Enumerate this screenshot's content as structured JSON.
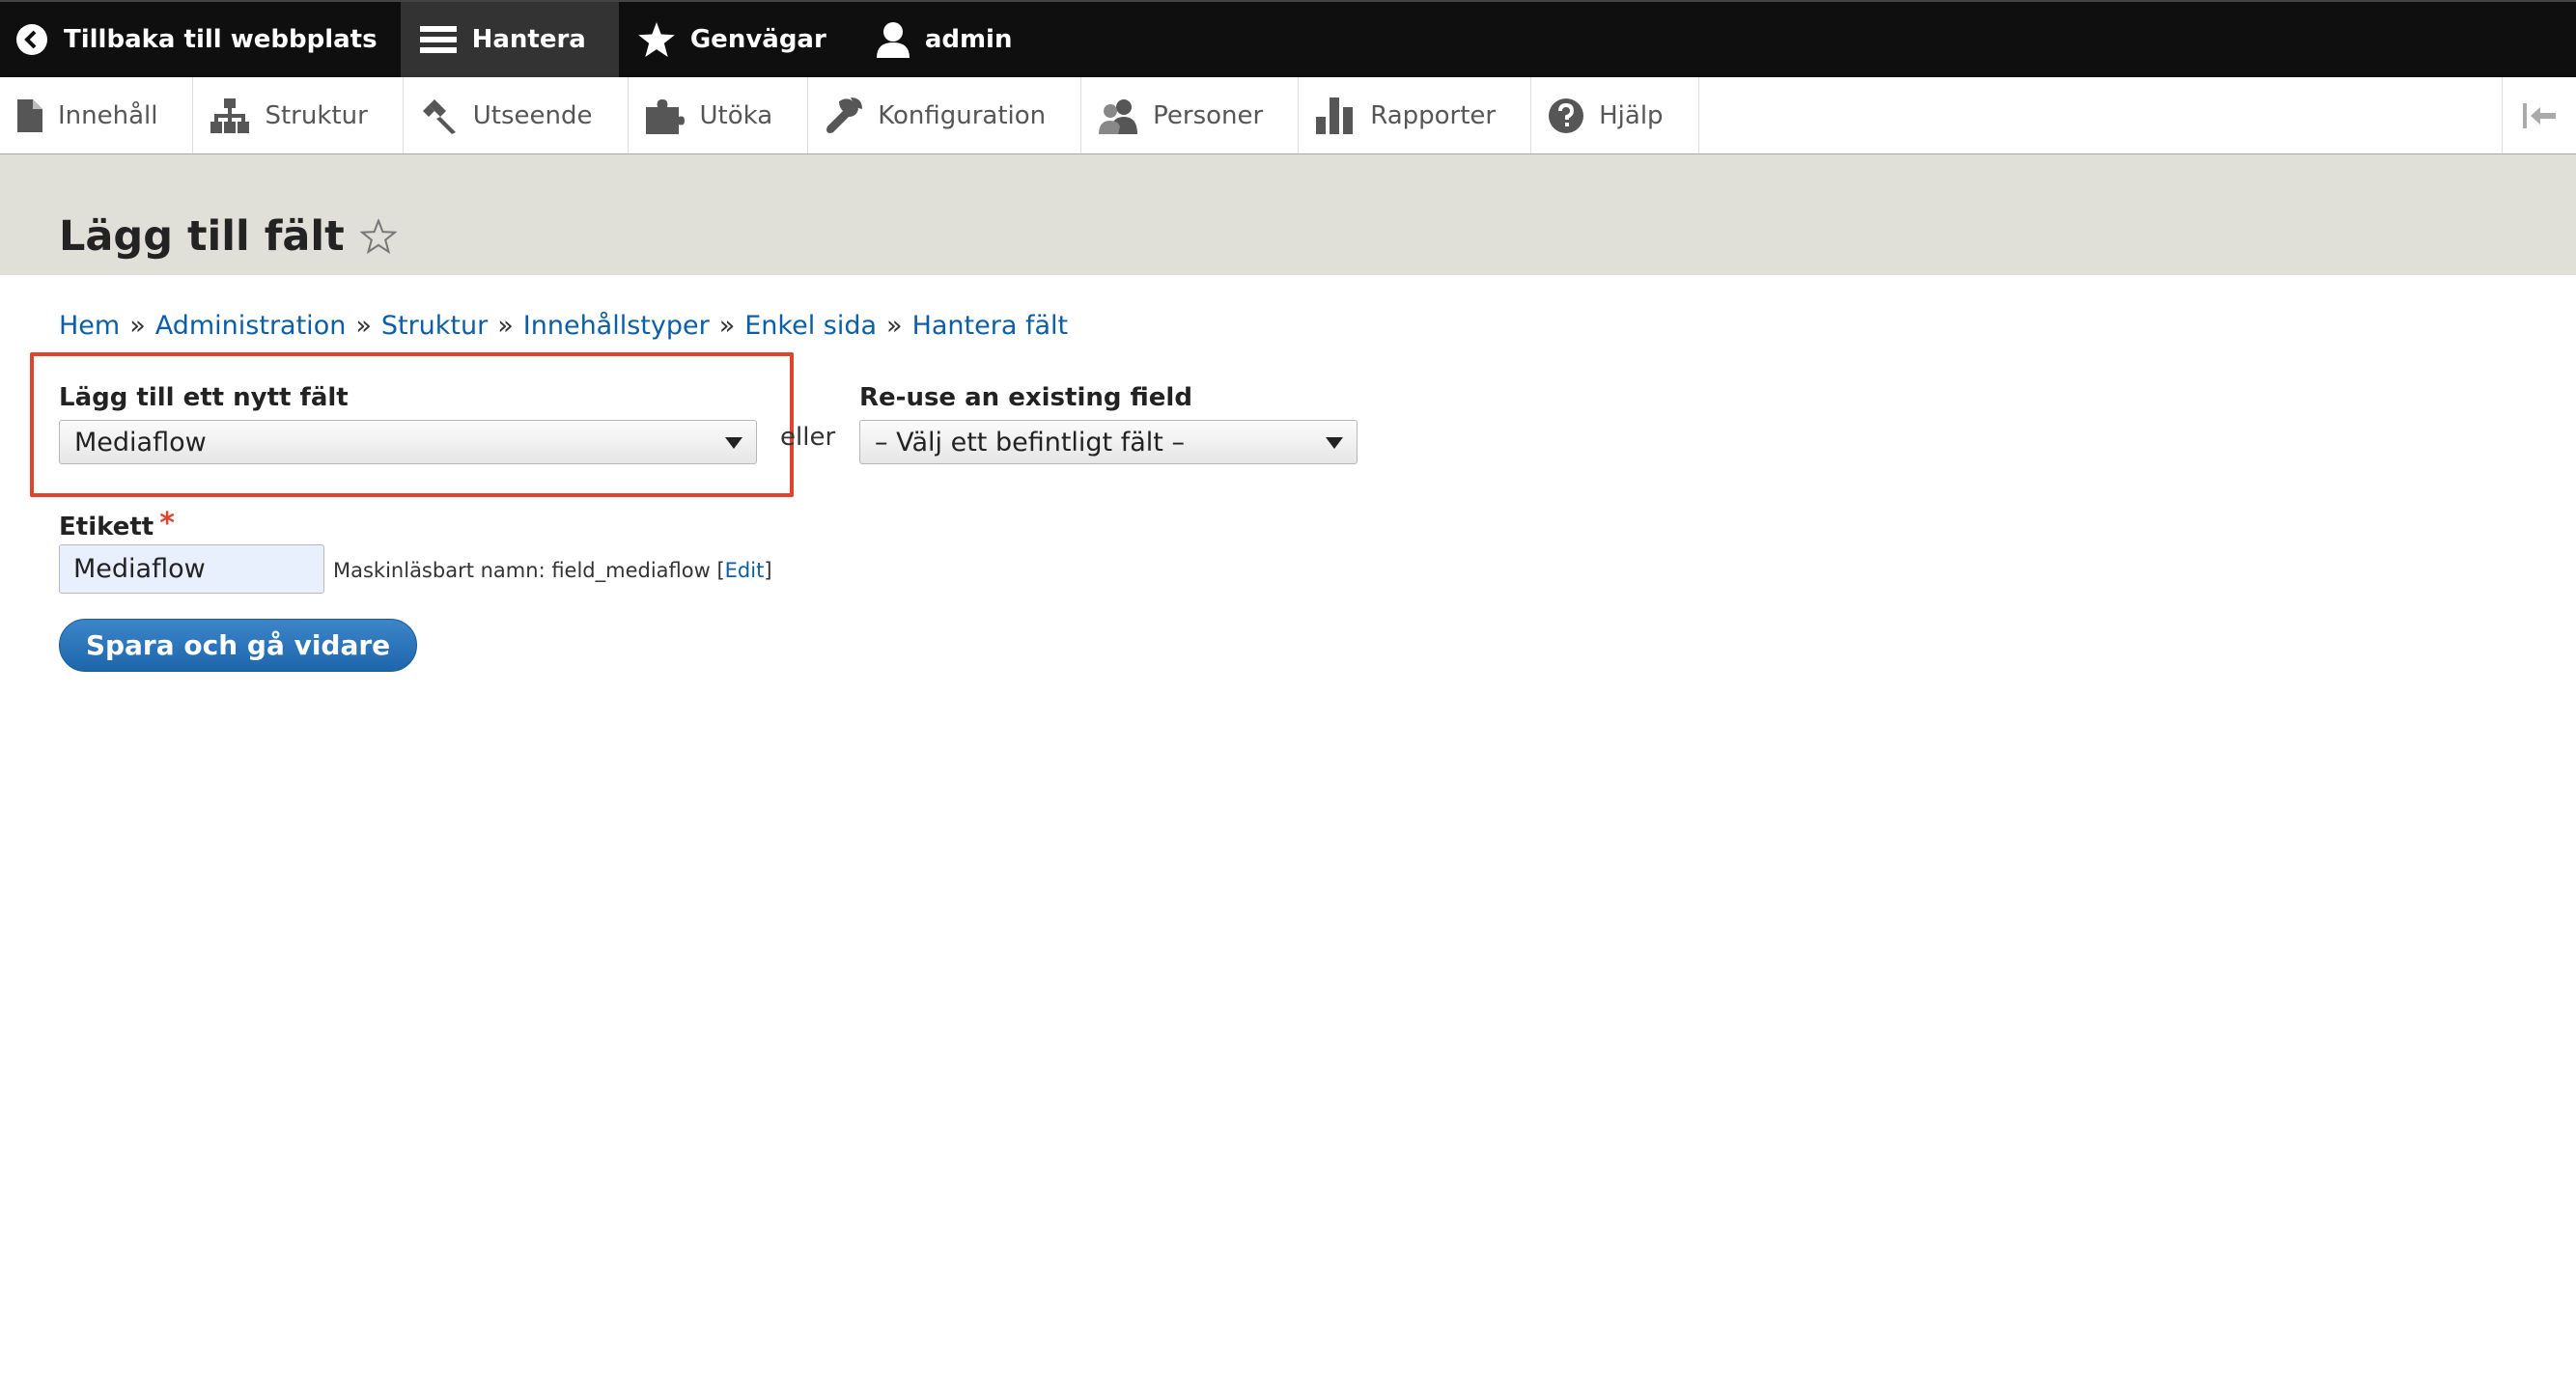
{
  "toolbar": {
    "back_label": "Tillbaka till webbplats",
    "manage_label": "Hantera",
    "shortcuts_label": "Genvägar",
    "user_label": "admin"
  },
  "tray": {
    "items": [
      {
        "label": "Innehåll",
        "icon": "file-icon"
      },
      {
        "label": "Struktur",
        "icon": "sitemap-icon"
      },
      {
        "label": "Utseende",
        "icon": "paintbrush-icon"
      },
      {
        "label": "Utöka",
        "icon": "puzzle-icon"
      },
      {
        "label": "Konfiguration",
        "icon": "wrench-icon"
      },
      {
        "label": "Personer",
        "icon": "people-icon"
      },
      {
        "label": "Rapporter",
        "icon": "bar-chart-icon"
      },
      {
        "label": "Hjälp",
        "icon": "help-icon"
      }
    ]
  },
  "page": {
    "title": "Lägg till fält"
  },
  "breadcrumb": [
    "Hem",
    "Administration",
    "Struktur",
    "Innehållstyper",
    "Enkel sida",
    "Hantera fält"
  ],
  "breadcrumb_separator": "»",
  "form": {
    "new_field_label": "Lägg till ett nytt fält",
    "new_field_value": "Mediaflow",
    "or_label": "eller",
    "existing_field_label": "Re-use an existing field",
    "existing_field_value": "– Välj ett befintligt fält –",
    "label_label": "Etikett",
    "required_mark": "*",
    "label_value": "Mediaflow",
    "machine_name_prefix": "Maskinläsbart namn: field_mediaflow [",
    "machine_name_edit": "Edit",
    "machine_name_suffix": "]",
    "submit_label": "Spara och gå vidare"
  },
  "colors": {
    "toolbar_bg": "#0f0f0f",
    "header_bg": "#e0e0d8",
    "link": "#0b5ea8",
    "highlight": "#e0442f",
    "primary_button": "#2b72b9"
  }
}
